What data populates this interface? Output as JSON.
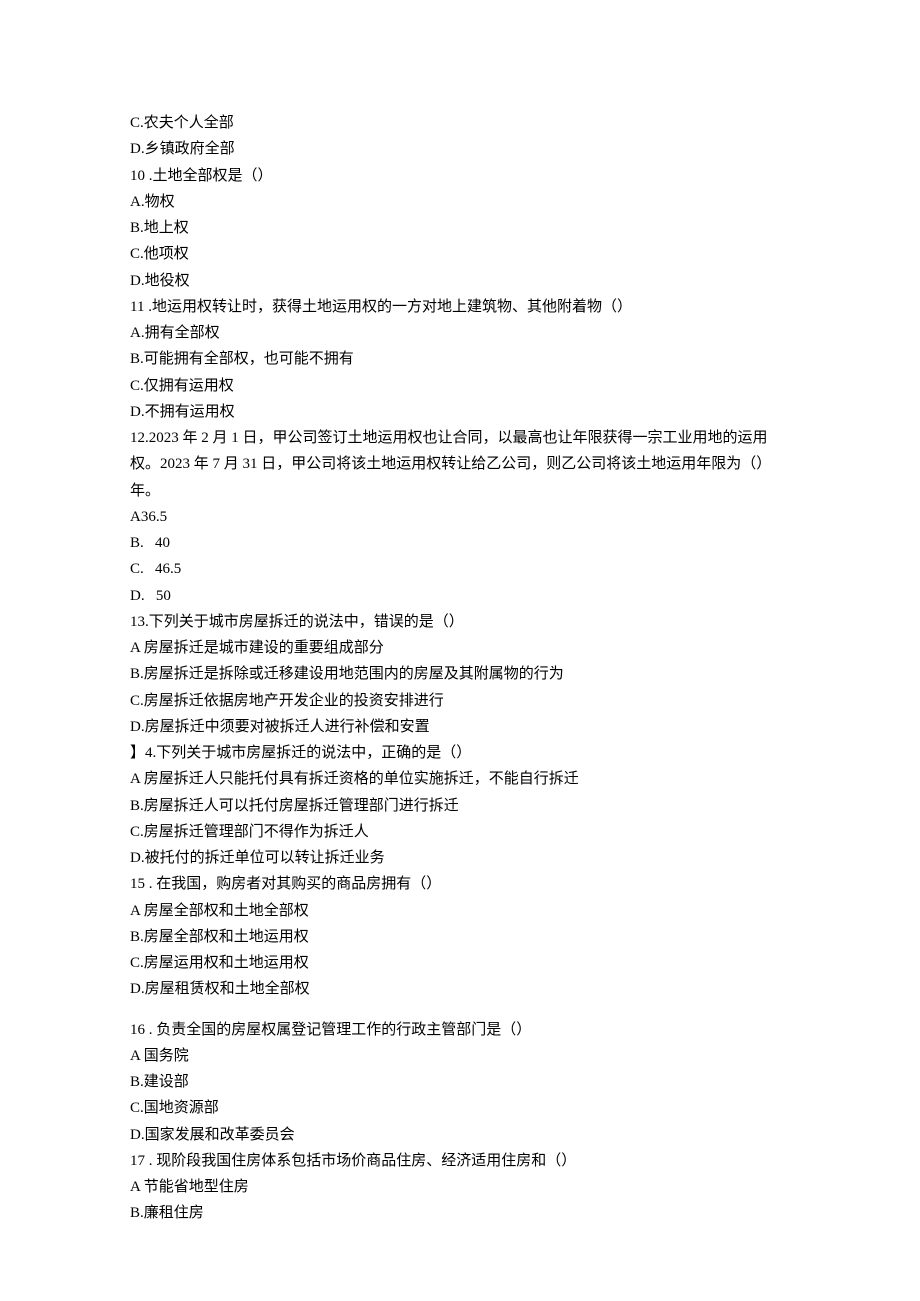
{
  "lines": [
    "C.农夫个人全部",
    "D.乡镇政府全部",
    "10 .土地全部权是（）",
    "A.物权",
    "B.地上权",
    "C.他项权",
    "D.地役权",
    "11 .地运用权转让时，获得土地运用权的一方对地上建筑物、其他附着物（）",
    "A.拥有全部权",
    "B.可能拥有全部权，也可能不拥有",
    "C.仅拥有运用权",
    "D.不拥有运用权",
    "12.2023 年 2 月 1 日，甲公司签订土地运用权也让合同，以最高也让年限获得一宗工业用地的运用权。2023 年 7 月 31 日，甲公司将该土地运用权转让给乙公司，则乙公司将该土地运用年限为（）年。",
    "A36.5",
    "B.   40",
    "C.   46.5",
    "D.   50",
    "13.下列关于城市房屋拆迁的说法中，错误的是（）",
    "A 房屋拆迁是城市建设的重要组成部分",
    "B.房屋拆迁是拆除或迁移建设用地范围内的房屋及其附属物的行为",
    "C.房屋拆迁依据房地产开发企业的投资安排进行",
    "D.房屋拆迁中须要对被拆迁人进行补偿和安置",
    "】4.下列关于城市房屋拆迁的说法中，正确的是（）",
    "A 房屋拆迁人只能托付具有拆迁资格的单位实施拆迁，不能自行拆迁",
    "B.房屋拆迁人可以托付房屋拆迁管理部门进行拆迁",
    "C.房屋拆迁管理部门不得作为拆迁人",
    "D.被托付的拆迁单位可以转让拆迁业务",
    "15 . 在我国，购房者对其购买的商品房拥有（）",
    "A 房屋全部权和土地全部权",
    "B.房屋全部权和土地运用权",
    "C.房屋运用权和土地运用权",
    "D.房屋租赁权和土地全部权",
    "",
    "16 . 负责全国的房屋权属登记管理工作的行政主管部门是（）",
    "A 国务院",
    "B.建设部",
    "C.国地资源部",
    "D.国家发展和改革委员会",
    "17 . 现阶段我国住房体系包括市场价商品住房、经济适用住房和（）",
    "A 节能省地型住房",
    "B.廉租住房"
  ]
}
